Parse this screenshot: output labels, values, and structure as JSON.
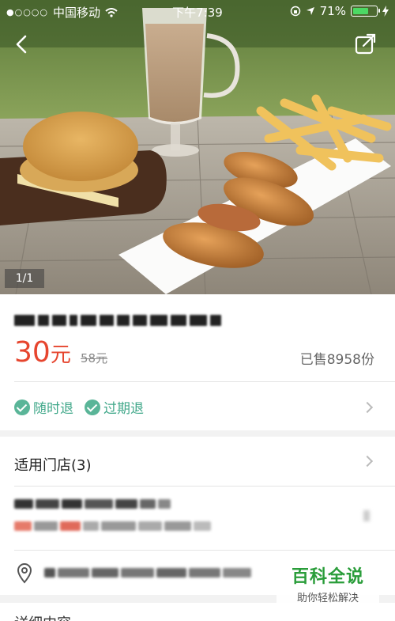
{
  "status_bar": {
    "carrier": "中国移动",
    "time": "下午7:39",
    "battery": "71%",
    "battery_level": 0.71
  },
  "gallery": {
    "page_indicator": "1/1"
  },
  "deal": {
    "price": "30",
    "price_unit": "元",
    "original_price": "58元",
    "sold": "已售8958份",
    "tags": [
      "随时退",
      "过期退"
    ]
  },
  "stores": {
    "title": "适用门店(3)"
  },
  "watermark": {
    "title": "百科全说",
    "subtitle": "助你轻松解决"
  },
  "detail": {
    "title": "详细内容"
  },
  "colors": {
    "price": "#e6452e",
    "tag": "#41a88a",
    "battery": "#4cd964",
    "watermark": "#2a9d3a"
  }
}
